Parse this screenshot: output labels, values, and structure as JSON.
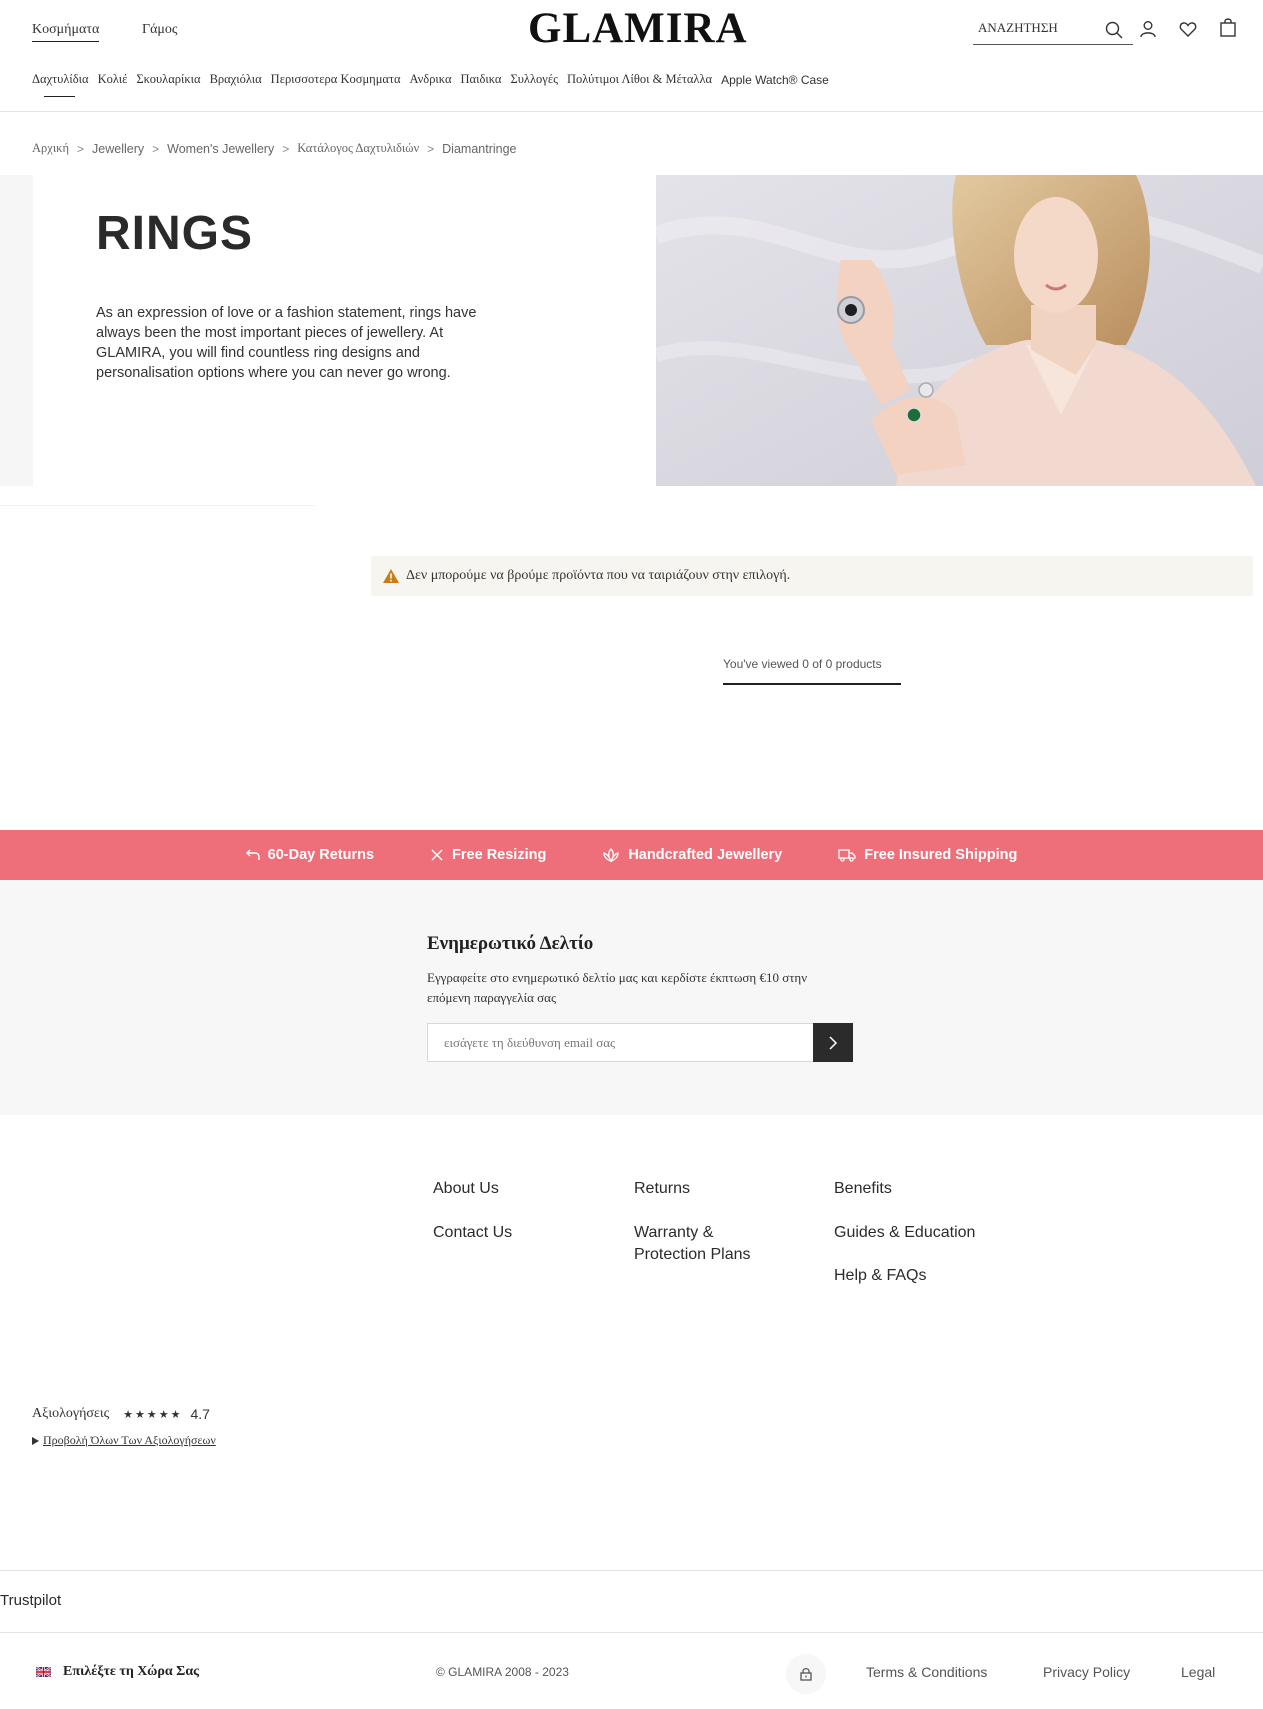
{
  "header": {
    "tabs": [
      "Κοσμήματα",
      "Γάμος"
    ],
    "logo": "GLAMIRA",
    "search_label": "ΑΝΑΖΗΤΗΣΗ",
    "categories": [
      "Δαχτυλίδια",
      "Κολιέ",
      "Σκουλαρίκια",
      "Βραχιόλια",
      "Περισσοτερα Κοσμηματα",
      "Ανδρικα",
      "Παιδικα",
      "Συλλογές",
      "Πολύτιμοι Λίθοι & Μέταλλα",
      "Apple Watch® Case"
    ]
  },
  "breadcrumb": [
    "Αρχική",
    "Jewellery",
    "Women's Jewellery",
    "Κατάλογος Δαχτυλιδιών",
    "Diamantringe"
  ],
  "hero": {
    "title": "RINGS",
    "text": "As an expression of love or a fashion statement, rings have always been the most important pieces of jewellery. At GLAMIRA, you will find countless ring designs and personalisation options where you can never go wrong."
  },
  "notice": "Δεν μπορούμε να βρούμε προϊόντα που να ταιριάζουν στην επιλογή.",
  "viewed": "You've viewed 0 of 0 products",
  "benefits": [
    "60-Day Returns",
    "Free Resizing",
    "Handcrafted Jewellery",
    "Free Insured Shipping"
  ],
  "newsletter": {
    "title": "Ενημερωτικό Δελτίο",
    "text": "Εγγραφείτε στο ενημερωτικό δελτίο μας και κερδίστε έκπτωση €10 στην επόμενη παραγγελία σας",
    "placeholder": "εισάγετε τη διεύθυνση email σας"
  },
  "footer_links": {
    "col1": [
      "About Us",
      "Contact Us"
    ],
    "col2": [
      "Returns",
      "Warranty & Protection Plans"
    ],
    "col3": [
      "Benefits",
      "Guides & Education",
      "Help & FAQs"
    ]
  },
  "rating": {
    "label": "Αξιολογήσεις",
    "stars": "★★★★★",
    "value": "4.7",
    "link": "Προβολή Όλων Των Αξιολογήσεων"
  },
  "trustpilot": "Trustpilot",
  "bottom": {
    "country": "Επιλέξτε τη Χώρα Σας",
    "copyright": "© GLAMIRA 2008 - 2023",
    "links": [
      "Terms & Conditions",
      "Privacy Policy",
      "Legal"
    ]
  },
  "colors": {
    "accent": "#ee6f79",
    "notice_bg": "#f7f5f0",
    "newsletter_bg": "#f7f7f7"
  }
}
